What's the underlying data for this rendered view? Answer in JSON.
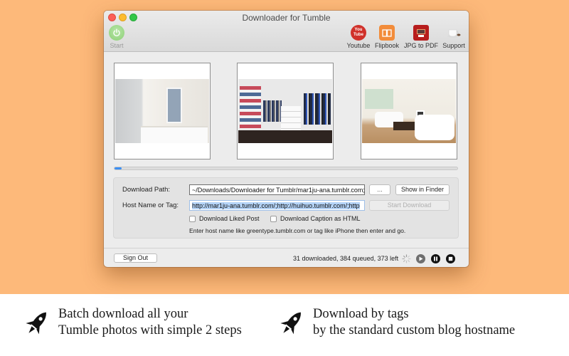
{
  "window": {
    "title": "Downloader for Tumble"
  },
  "toolbar": {
    "start_label": "Start",
    "tools": [
      {
        "label": "Youtube",
        "icon": "youtube-icon",
        "icon_text_top": "You",
        "icon_text_bottom": "Tube",
        "color": "#d0312a"
      },
      {
        "label": "Flipbook",
        "icon": "book-icon",
        "color": "#f28c3a"
      },
      {
        "label": "JPG to PDF",
        "icon": "jpg-to-pdf-icon",
        "color": "#b71d1d"
      },
      {
        "label": "Support",
        "icon": "coffee-cup-icon"
      }
    ]
  },
  "thumbnails": [
    {
      "subject": "bathroom"
    },
    {
      "subject": "walk-in closet"
    },
    {
      "subject": "living room"
    }
  ],
  "progress": {
    "fraction": 0.02,
    "color": "#3b8ff3"
  },
  "form": {
    "download_path_label": "Download Path:",
    "download_path_value": "~/Downloads/Downloader for Tumblr/mar1ju-ana.tumblr.com;",
    "browse_button": "...",
    "show_in_finder_button": "Show in Finder",
    "host_label": "Host Name or Tag:",
    "host_value": "http://mar1ju-ana.tumblr.com/;http://huihuo.tumblr.com/;http",
    "start_download_button": "Start Download",
    "checkbox_liked": {
      "label": "Download Liked Post",
      "checked": false
    },
    "checkbox_caption": {
      "label": "Download Caption as HTML",
      "checked": false
    },
    "hint": "Enter host name like greentype.tumblr.com or tag like iPhone then enter and go."
  },
  "footer": {
    "sign_out_button": "Sign Out",
    "status": "31 downloaded, 384 queued, 373 left"
  },
  "promo": [
    {
      "line1": "Batch download all your",
      "line2": "Tumble photos with simple 2 steps"
    },
    {
      "line1": "Download by tags",
      "line2": "by the standard custom blog hostname"
    }
  ],
  "colors": {
    "backdrop": "#fdb97a",
    "accent": "#3b8ff3"
  }
}
